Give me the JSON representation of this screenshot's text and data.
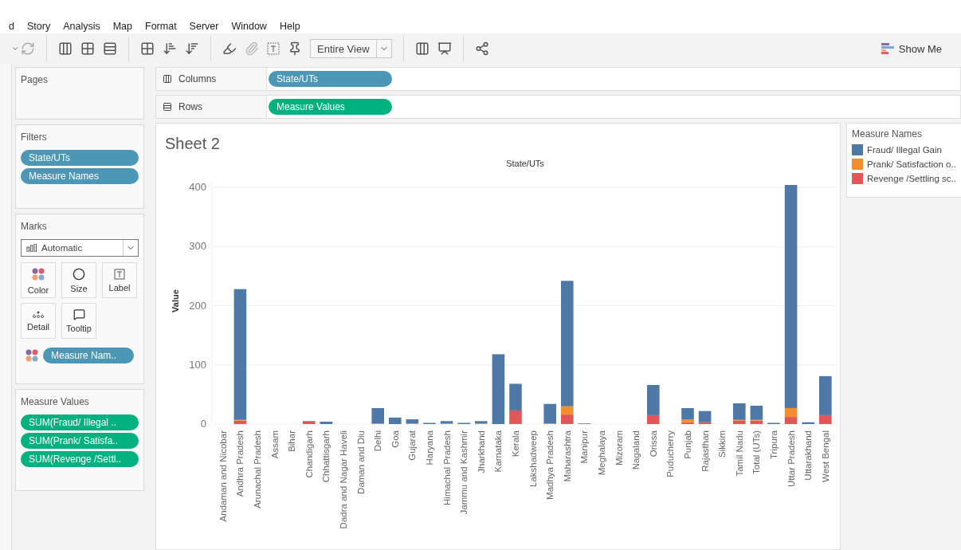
{
  "menu": [
    "d",
    "Story",
    "Analysis",
    "Map",
    "Format",
    "Server",
    "Window",
    "Help"
  ],
  "toolbar": {
    "fit_dropdown": "Entire View",
    "show_me": "Show Me"
  },
  "pages": {
    "title": "Pages"
  },
  "filters": {
    "title": "Filters",
    "pills": [
      "State/UTs",
      "Measure Names"
    ]
  },
  "marks": {
    "title": "Marks",
    "type": "Automatic",
    "cards": [
      {
        "kind": "color",
        "label": "Color"
      },
      {
        "kind": "size",
        "label": "Size"
      },
      {
        "kind": "label",
        "label": "Label"
      },
      {
        "kind": "detail",
        "label": "Detail"
      },
      {
        "kind": "tooltip",
        "label": "Tooltip"
      }
    ],
    "color_pill": "Measure Nam.."
  },
  "measure_values": {
    "title": "Measure Values",
    "pills": [
      "SUM(Fraud/ Illegal ..",
      "SUM(Prank/ Satisfa..",
      "SUM(Revenge /Settl.."
    ]
  },
  "shelves": [
    {
      "kind": "columns",
      "label": "Columns",
      "pill": "State/UTs"
    },
    {
      "kind": "rows",
      "label": "Rows",
      "pill": "Measure Values"
    }
  ],
  "sheet": {
    "title": "Sheet 2",
    "chart_data": {
      "type": "bar",
      "stacked": true,
      "grid": true,
      "orientation": "vertical",
      "title": "State/UTs",
      "ylabel": "Value",
      "ylim": [
        0,
        410
      ],
      "yticks": [
        0,
        100,
        200,
        300,
        400
      ],
      "categories": [
        "Andaman and Nicobar",
        "Andhra Pradesh",
        "Arunachal Pradesh",
        "Assam",
        "Bihar",
        "Chandigarh",
        "Chhattisgarh",
        "Dadra and Nagar Haveli",
        "Daman and Diu",
        "Delhi",
        "Goa",
        "Gujarat",
        "Haryana",
        "Himachal Pradesh",
        "Jammu and Kashmir",
        "Jharkhand",
        "Karnataka",
        "Kerala",
        "Lakshadweep",
        "Madhya Pradesh",
        "Maharashtra",
        "Manipur",
        "Meghalaya",
        "Mizoram",
        "Nagaland",
        "Orissa",
        "Puducherry",
        "Punjab",
        "Rajasthan",
        "Sikkim",
        "Tamil Nadu",
        "Total (UTs)",
        "Tripura",
        "Uttar Pradesh",
        "Uttarakhand",
        "West Bengal"
      ],
      "series": [
        {
          "name": "Revenge /Settling sc..",
          "color": "#e15759",
          "values": [
            0,
            6,
            0,
            0,
            0,
            4,
            0,
            0,
            0,
            0,
            0,
            0,
            0,
            0,
            0,
            0,
            0,
            23,
            0,
            0,
            16,
            0,
            0,
            0,
            0,
            15,
            0,
            3,
            3,
            0,
            6,
            6,
            0,
            12,
            0,
            15
          ]
        },
        {
          "name": "Prank/ Satisfaction o..",
          "color": "#f28e2b",
          "values": [
            0,
            1,
            0,
            0,
            0,
            0,
            0,
            0,
            0,
            1,
            0,
            1,
            0,
            1,
            0,
            1,
            0,
            0,
            0,
            1,
            14,
            0,
            0,
            0,
            0,
            0,
            0,
            5,
            0,
            0,
            1,
            1,
            0,
            15,
            0,
            0
          ]
        },
        {
          "name": "Fraud/ Illegal Gain",
          "color": "#4e79a7",
          "values": [
            0,
            221,
            0,
            0,
            0,
            1,
            4,
            0,
            0,
            26,
            11,
            7,
            2,
            4,
            2,
            4,
            118,
            45,
            0,
            33,
            212,
            1,
            0,
            0,
            0,
            51,
            0,
            19,
            19,
            0,
            28,
            24,
            2,
            377,
            3,
            66
          ]
        }
      ]
    }
  },
  "legend": {
    "title": "Measure Names"
  }
}
